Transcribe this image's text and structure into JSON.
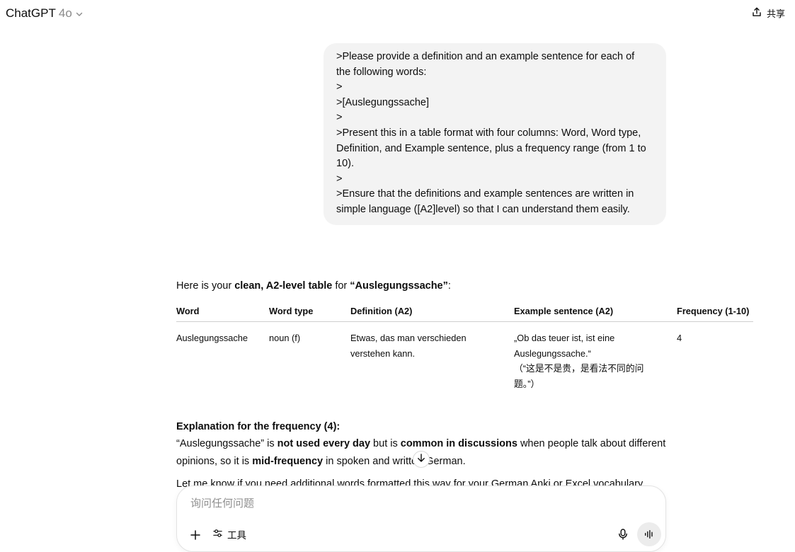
{
  "header": {
    "model_name": "ChatGPT",
    "model_version": "4o",
    "share_label": "共享"
  },
  "user_message": {
    "lines": [
      ">Please provide a definition and an example sentence for each of",
      "the following words:",
      ">",
      ">[Auslegungssache]",
      ">",
      ">Present this in a table format with four columns: Word, Word type,",
      "Definition, and Example sentence, plus a frequency range (from 1 to",
      "10).",
      ">",
      ">Ensure that the definitions and example sentences are written in",
      "simple language ([A2]level) so that I can understand them easily."
    ]
  },
  "assistant": {
    "intro_pre": "Here is your ",
    "intro_bold1": "clean, A2-level table",
    "intro_mid": " for ",
    "intro_bold2": "“Auslegungssache”",
    "intro_post": ":",
    "table": {
      "headers": [
        "Word",
        "Word type",
        "Definition (A2)",
        "Example sentence (A2)",
        "Frequency (1-10)"
      ],
      "rows": [
        {
          "word": "Auslegungssache",
          "type": "noun (f)",
          "definition": "Etwas, das man verschieden verstehen kann.",
          "example": "„Ob das teuer ist, ist eine Auslegungssache.“",
          "example_translation": "（“这是不是贵，是看法不同的问题。”）",
          "frequency": "4"
        }
      ]
    },
    "explain_title": "Explanation for the frequency (4):",
    "explain_p1": "“Auslegungssache” is ",
    "explain_b1": "not used every day",
    "explain_p2": " but is ",
    "explain_b2": "common in discussions",
    "explain_p3": " when people talk about different opinions, so it is ",
    "explain_b3": "mid-frequency",
    "explain_p4": " in spoken and written German.",
    "closing": "Let me know if you need additional words formatted this way for your German Anki or Excel vocabulary"
  },
  "composer": {
    "placeholder": "询问任何问题",
    "tools_label": "工具"
  }
}
